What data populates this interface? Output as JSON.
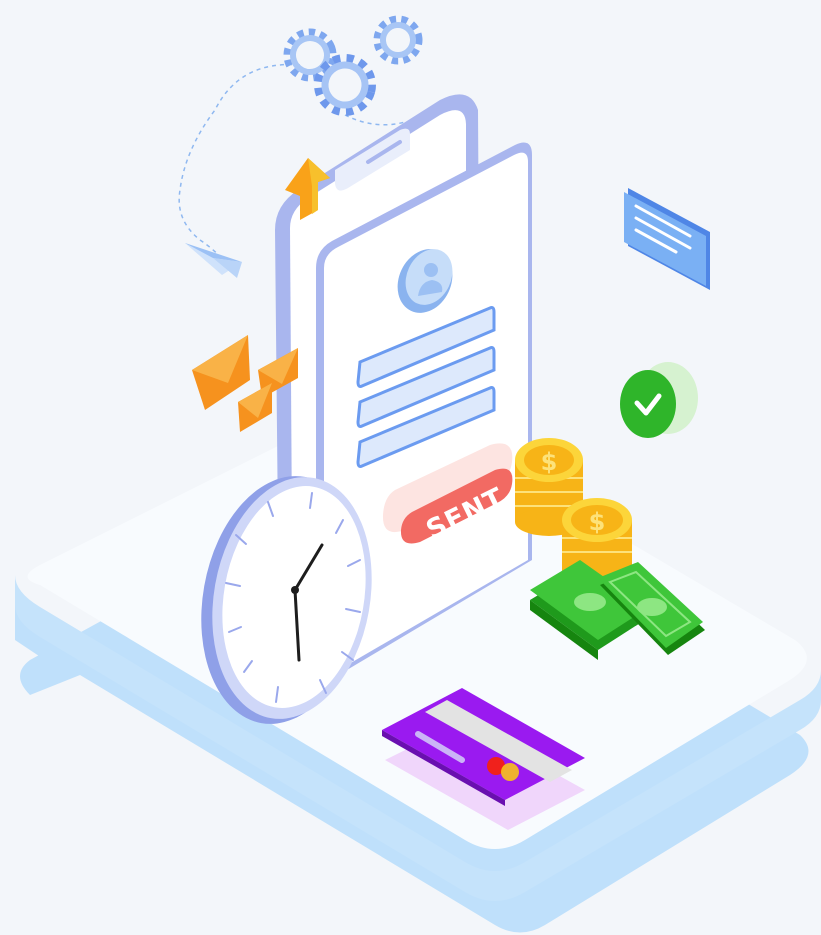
{
  "illustration": {
    "sent_button_label": "SENT",
    "coin_symbol": "$",
    "icons": [
      "gear-icon",
      "paper-plane-icon",
      "upload-arrow-icon",
      "envelope-icon",
      "user-avatar-icon",
      "chat-message-icon",
      "checkmark-icon",
      "clock-icon",
      "coin-stack-icon",
      "cash-icon",
      "credit-card-icon"
    ],
    "colors": {
      "background": "#f3f6fa",
      "platform_top": "#f8fbfe",
      "platform_side": "#bfe0fb",
      "phone_outline": "#a9b6ee",
      "accent_blue": "#6b9bf0",
      "sent_red": "#f26a63",
      "coin_gold": "#f8c21a",
      "cash_green": "#3fc63a",
      "card_purple": "#9a1af0",
      "check_green": "#2fb52a",
      "envelope_orange": "#f6921e"
    }
  }
}
